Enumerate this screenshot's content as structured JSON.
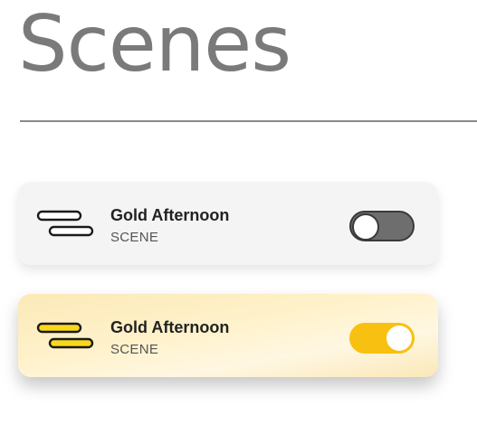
{
  "page": {
    "title": "Scenes"
  },
  "scenes": [
    {
      "name": "Gold Afternoon",
      "type_label": "SCENE",
      "state": "off",
      "icon": "scene-lines-icon",
      "icon_fill": "#ffffff",
      "toggle_color": "#6e6e6e"
    },
    {
      "name": "Gold Afternoon",
      "type_label": "SCENE",
      "state": "on",
      "icon": "scene-lines-icon",
      "icon_fill": "#f8d81c",
      "toggle_color": "#f8c010"
    }
  ],
  "colors": {
    "title": "#7a7a7a",
    "active_card": "#fff2cc",
    "inactive_card": "#f4f4f4"
  }
}
